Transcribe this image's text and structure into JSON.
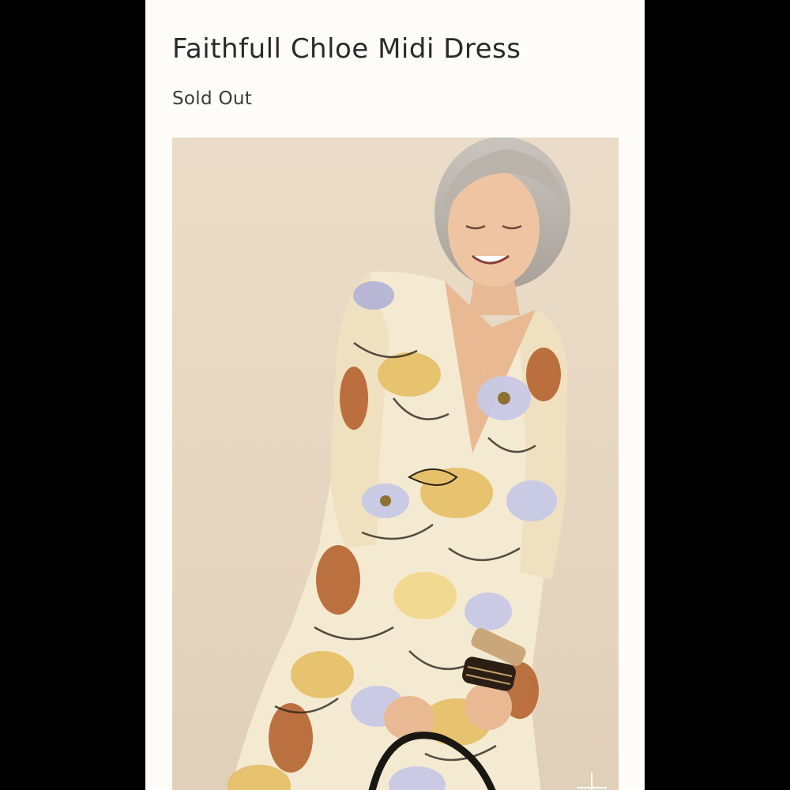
{
  "product": {
    "title": "Faithfull Chloe Midi Dress",
    "status": "Sold Out"
  },
  "image": {
    "subject": "model-in-floral-midi-dress",
    "background_color": "#e8d9c4"
  },
  "zoom": {
    "icon": "plus-icon"
  },
  "colors": {
    "page_background": "#fdfcf8",
    "outer_background": "#000000",
    "text": "#2a2a2a"
  }
}
